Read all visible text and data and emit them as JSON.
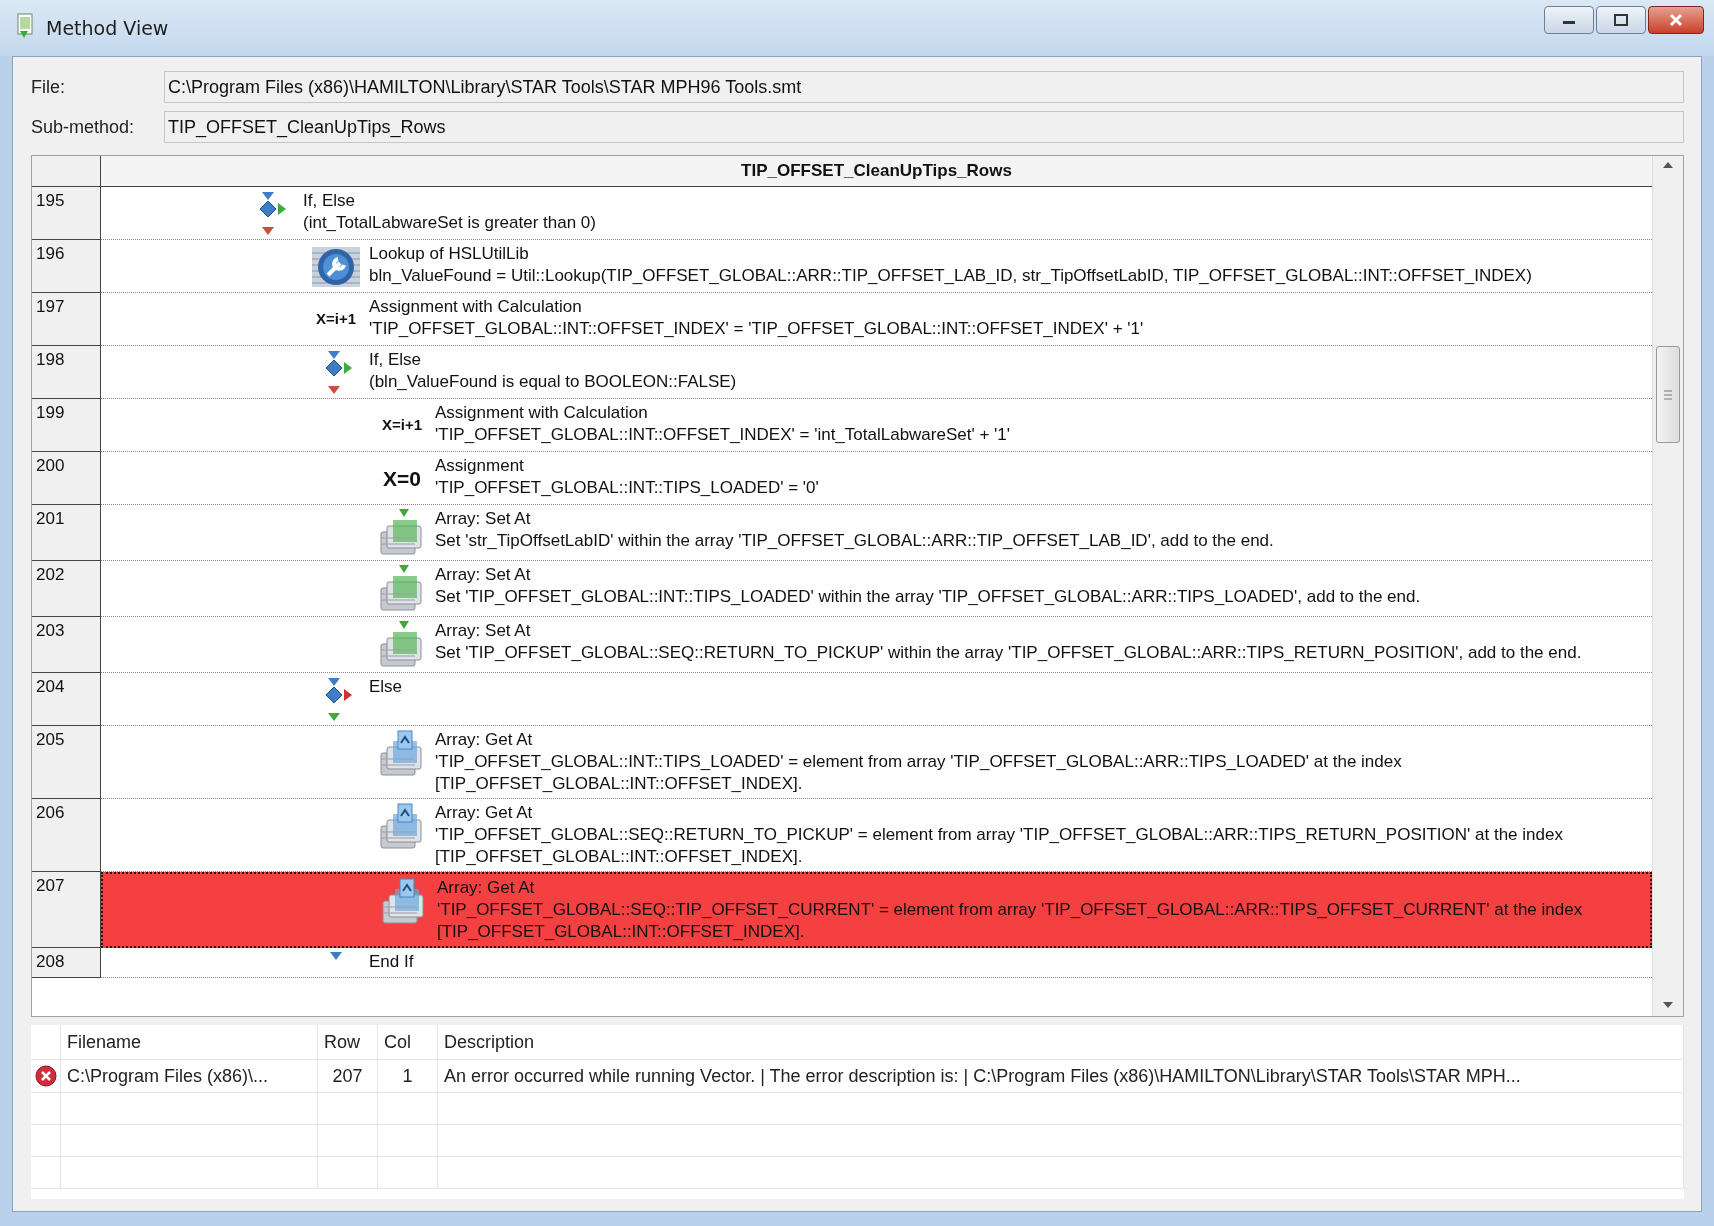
{
  "window": {
    "title": "Method View"
  },
  "fields": [
    {
      "label": "File:",
      "value": "C:\\Program Files (x86)\\HAMILTON\\Library\\STAR Tools\\STAR MPH96 Tools.smt"
    },
    {
      "label": "Sub-method:",
      "value": "TIP_OFFSET_CleanUpTips_Rows"
    }
  ],
  "grid": {
    "header": "TIP_OFFSET_CleanUpTips_Rows",
    "steps": [
      {
        "line": "195",
        "kind": "if",
        "title": "If, Else",
        "detail": "(int_TotalLabwareSet is greater than 0)",
        "selected": false,
        "children": [
          {
            "line": "196",
            "kind": "lookup",
            "title": "Lookup of HSLUtilLib",
            "detail": "bln_ValueFound = Util::Lookup(TIP_OFFSET_GLOBAL::ARR::TIP_OFFSET_LAB_ID, str_TipOffsetLabID, TIP_OFFSET_GLOBAL::INT::OFFSET_INDEX)",
            "selected": false
          },
          {
            "line": "197",
            "kind": "calc",
            "icon_text": "X=i+1",
            "title": "Assignment with Calculation",
            "detail": "'TIP_OFFSET_GLOBAL::INT::OFFSET_INDEX' = 'TIP_OFFSET_GLOBAL::INT::OFFSET_INDEX' + '1'",
            "selected": false
          },
          {
            "line": "198",
            "kind": "if",
            "title": "If, Else",
            "detail": "(bln_ValueFound is equal to BOOLEON::FALSE)",
            "selected": false,
            "children": [
              {
                "line": "199",
                "kind": "calc",
                "icon_text": "X=i+1",
                "title": "Assignment with Calculation",
                "detail": "'TIP_OFFSET_GLOBAL::INT::OFFSET_INDEX' = 'int_TotalLabwareSet' + '1'",
                "selected": false
              },
              {
                "line": "200",
                "kind": "assign",
                "icon_text": "X=0",
                "title": "Assignment",
                "detail": "'TIP_OFFSET_GLOBAL::INT::TIPS_LOADED' = '0'",
                "selected": false
              },
              {
                "line": "201",
                "kind": "array_set",
                "title": "Array: Set At",
                "detail": "Set 'str_TipOffsetLabID' within the array 'TIP_OFFSET_GLOBAL::ARR::TIP_OFFSET_LAB_ID', add to the end.",
                "selected": false
              },
              {
                "line": "202",
                "kind": "array_set",
                "title": "Array: Set At",
                "detail": "Set 'TIP_OFFSET_GLOBAL::INT::TIPS_LOADED' within the array 'TIP_OFFSET_GLOBAL::ARR::TIPS_LOADED', add to the end.",
                "selected": false
              },
              {
                "line": "203",
                "kind": "array_set",
                "title": "Array: Set At",
                "detail": "Set 'TIP_OFFSET_GLOBAL::SEQ::RETURN_TO_PICKUP' within the array 'TIP_OFFSET_GLOBAL::ARR::TIPS_RETURN_POSITION', add to the end.",
                "selected": false
              }
            ]
          },
          {
            "line": "204",
            "kind": "else",
            "title": "Else",
            "selected": false,
            "children": [
              {
                "line": "205",
                "kind": "array_get",
                "title": "Array: Get At",
                "detail": "'TIP_OFFSET_GLOBAL::INT::TIPS_LOADED' = element from array 'TIP_OFFSET_GLOBAL::ARR::TIPS_LOADED' at the index [TIP_OFFSET_GLOBAL::INT::OFFSET_INDEX].",
                "selected": false
              },
              {
                "line": "206",
                "kind": "array_get",
                "title": "Array: Get At",
                "detail": "'TIP_OFFSET_GLOBAL::SEQ::RETURN_TO_PICKUP' = element from array 'TIP_OFFSET_GLOBAL::ARR::TIPS_RETURN_POSITION' at the index [TIP_OFFSET_GLOBAL::INT::OFFSET_INDEX].",
                "selected": false
              },
              {
                "line": "207",
                "kind": "array_get",
                "title": "Array: Get At",
                "detail": "'TIP_OFFSET_GLOBAL::SEQ::TIP_OFFSET_CURRENT' = element from array 'TIP_OFFSET_GLOBAL::ARR::TIPS_OFFSET_CURRENT' at the index [TIP_OFFSET_GLOBAL::INT::OFFSET_INDEX].",
                "selected": true
              }
            ]
          },
          {
            "line": "208",
            "kind": "endif",
            "title": "End If",
            "selected": false
          }
        ]
      }
    ]
  },
  "errors": {
    "columns": [
      "Filename",
      "Row",
      "Col",
      "Description"
    ],
    "rows": [
      {
        "kind": "error",
        "filename": "C:\\Program Files (x86)\\...",
        "row": "207",
        "col": "1",
        "description": "An error occurred while running Vector. | The error description is: | C:\\Program Files (x86)\\HAMILTON\\Library\\STAR Tools\\STAR MPH..."
      }
    ]
  }
}
